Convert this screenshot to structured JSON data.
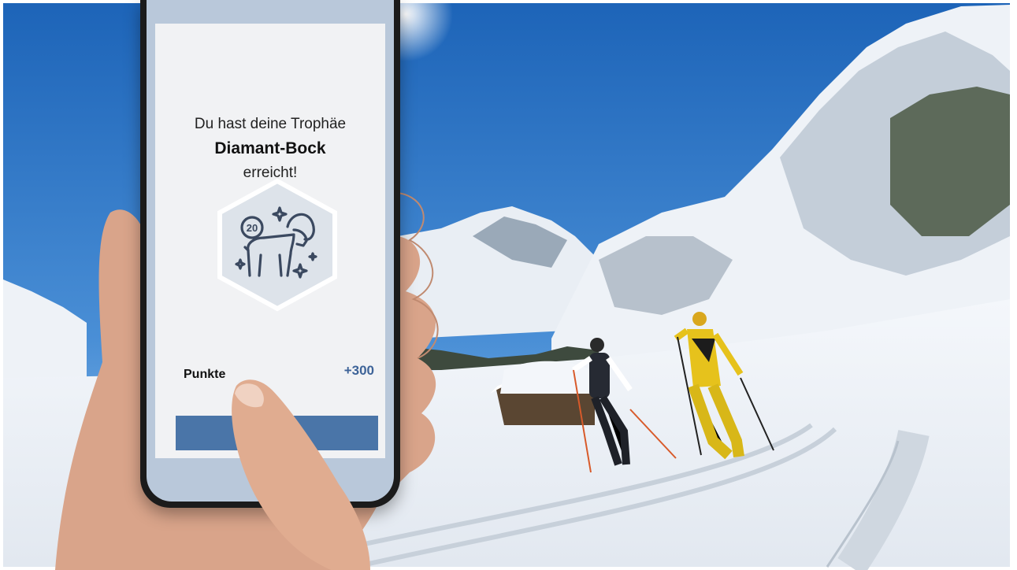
{
  "screen": {
    "headline_line1": "Du hast deine Trophäe",
    "trophy_name": "Diamant-Bock",
    "headline_line3": "erreicht!",
    "badge_number": "20",
    "points_label": "Punkte",
    "points_value": "+300",
    "cta_label": ""
  },
  "icons": {
    "badge": "ibex-trophy-icon"
  },
  "colors": {
    "accent": "#4a75a8",
    "points": "#3d6398",
    "badge_bg": "#dde3ea"
  }
}
